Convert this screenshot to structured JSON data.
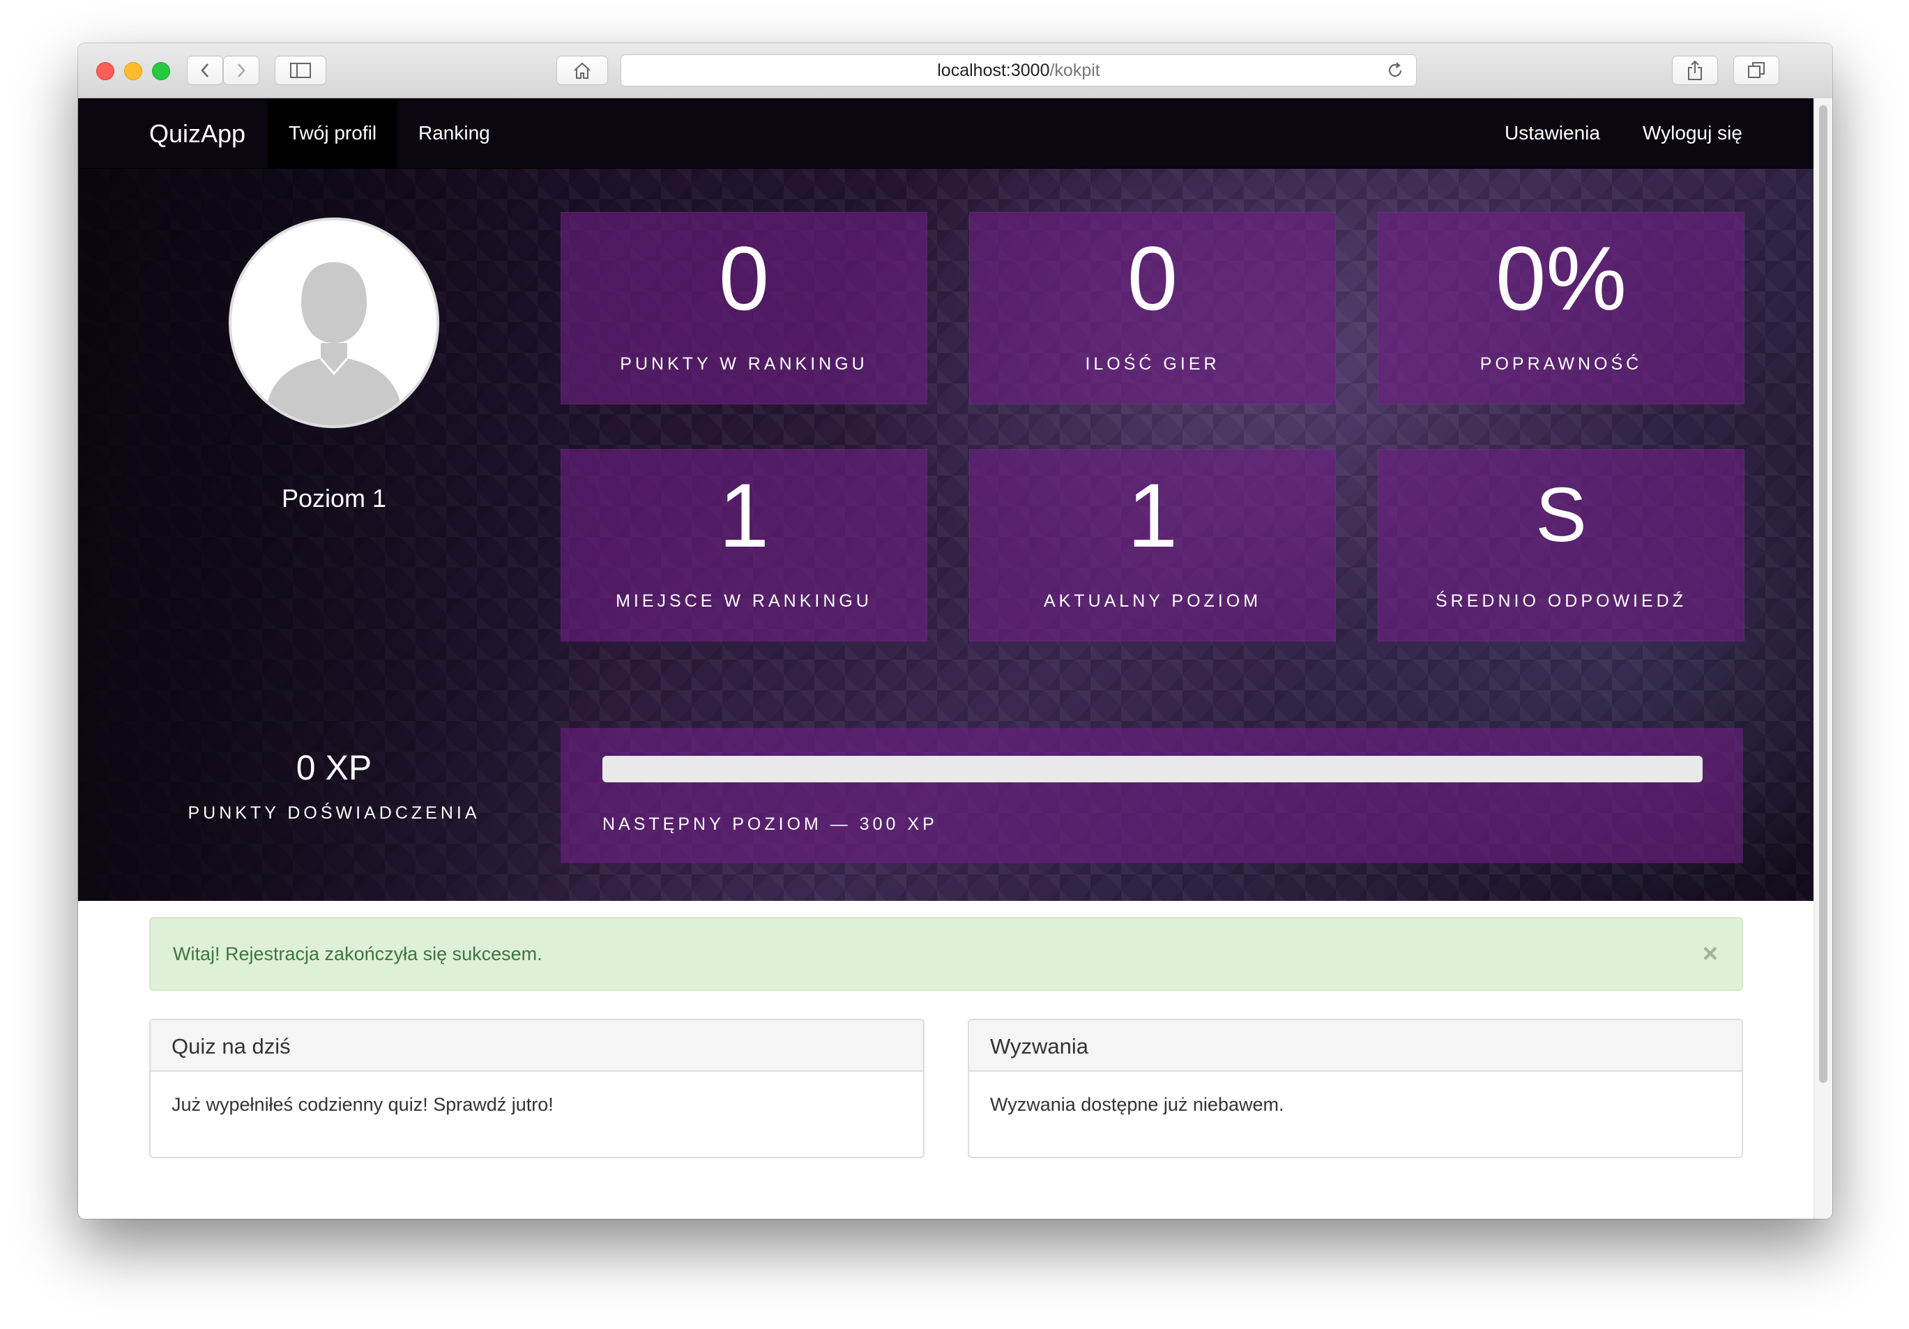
{
  "browser": {
    "url_host": "localhost:3000",
    "url_path": "/kokpit"
  },
  "navbar": {
    "brand": "QuizApp",
    "links": [
      {
        "label": "Twój profil",
        "active": true
      },
      {
        "label": "Ranking",
        "active": false
      }
    ],
    "right_links": [
      {
        "label": "Ustawienia"
      },
      {
        "label": "Wyloguj się"
      }
    ]
  },
  "profile": {
    "level_label": "Poziom 1",
    "xp_value": "0 XP",
    "xp_caption": "PUNKTY DOŚWIADCZENIA"
  },
  "stats": [
    {
      "value": "0",
      "label": "PUNKTY W RANKINGU"
    },
    {
      "value": "0",
      "label": "ILOŚĆ GIER"
    },
    {
      "value": "0%",
      "label": "POPRAWNOŚĆ"
    },
    {
      "value": "1",
      "label": "MIEJSCE W RANKINGU"
    },
    {
      "value": "1",
      "label": "AKTUALNY POZIOM"
    },
    {
      "value": "S",
      "label": "ŚREDNIO ODPOWIEDŹ"
    }
  ],
  "progress": {
    "fraction": 0,
    "label": "NASTĘPNY POZIOM — 300 XP"
  },
  "alert": {
    "text": "Witaj! Rejestracja zakończyła się sukcesem.",
    "close": "×"
  },
  "panels": [
    {
      "title": "Quiz na dziś",
      "body": "Już wypełniłeś codzienny quiz! Sprawdź jutro!"
    },
    {
      "title": "Wyzwania",
      "body": "Wyzwania dostępne już niebawem."
    }
  ],
  "colors": {
    "tile": "#6e1e82",
    "progress_fill": "#9b59b6",
    "alert_bg": "#dff0d8",
    "alert_text": "#3c763d",
    "navbar_bg": "#0a0710"
  }
}
